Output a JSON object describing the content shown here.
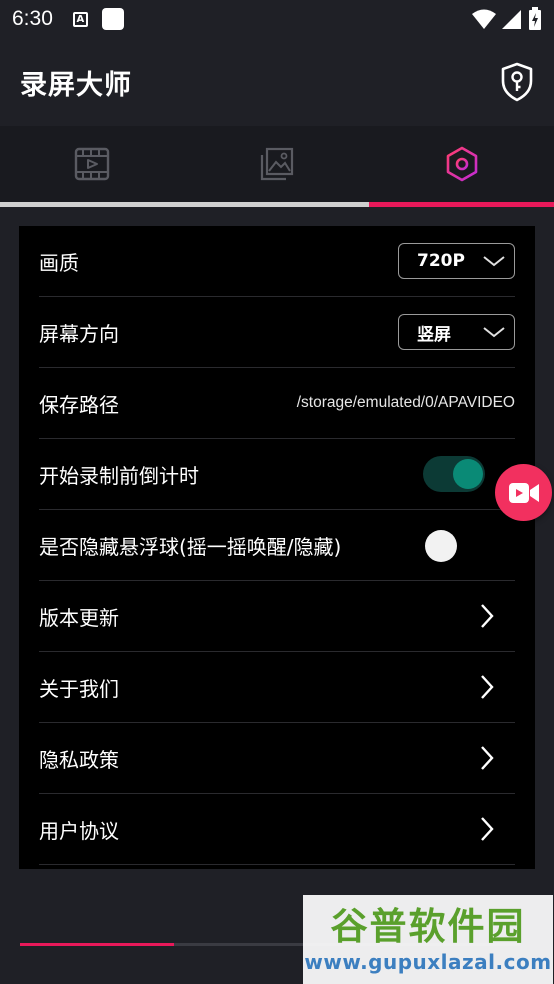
{
  "status_bar": {
    "time": "6:30",
    "a_badge": "A"
  },
  "app_bar": {
    "title": "录屏大师",
    "action_icon": "shield-key-icon"
  },
  "tabs": [
    {
      "icon": "video-film-icon",
      "active": false
    },
    {
      "icon": "image-gallery-icon",
      "active": false
    },
    {
      "icon": "hexagon-settings-icon",
      "active": true
    }
  ],
  "settings": {
    "quality": {
      "label": "画质",
      "value": "720P"
    },
    "orientation": {
      "label": "屏幕方向",
      "value": "竖屏"
    },
    "save_path": {
      "label": "保存路径",
      "value": "/storage/emulated/0/APAVIDEO"
    },
    "countdown": {
      "label": "开始录制前倒计时",
      "enabled": true
    },
    "hide_float": {
      "label": "是否隐藏悬浮球(摇一摇唤醒/隐藏)",
      "enabled": false
    },
    "version_update": {
      "label": "版本更新"
    },
    "about_us": {
      "label": "关于我们"
    },
    "privacy_policy": {
      "label": "隐私政策"
    },
    "user_agreement": {
      "label": "用户协议"
    }
  },
  "floating_button": {
    "icon": "video-camera-icon"
  },
  "watermark": {
    "title": "谷普软件园",
    "url": "www.gupuxlazal.com"
  },
  "colors": {
    "accent": "#e8195a",
    "background": "#1f2026",
    "panel": "#000000",
    "toggle_on": "#0a8a76",
    "float_button": "#f2305f"
  }
}
